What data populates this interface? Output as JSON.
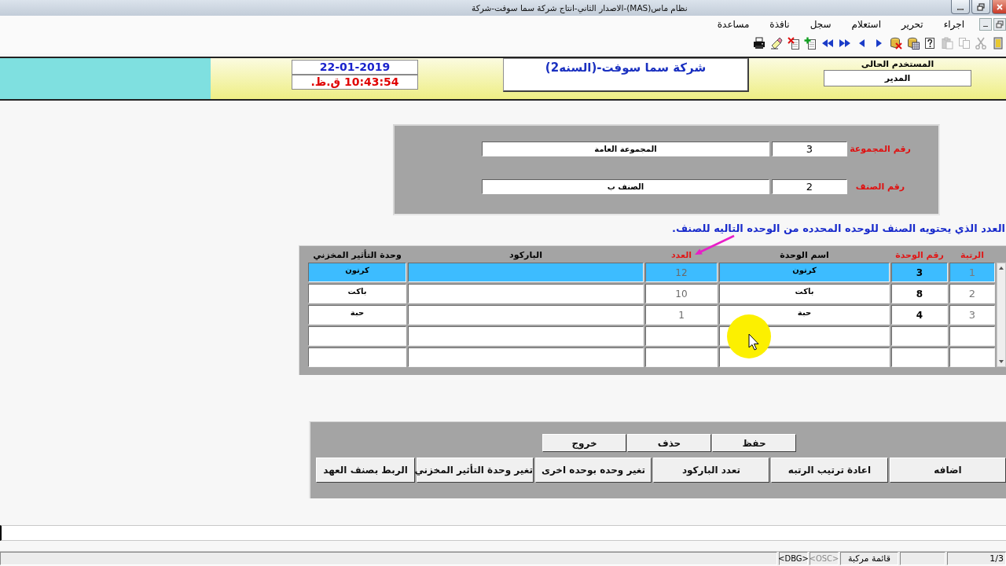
{
  "window": {
    "title": "نظام ماس(MAS)-الاصدار الثاني-انتاج شركة سما سوفت-شركة"
  },
  "menu": [
    "اجراء",
    "تحرير",
    "استعلام",
    "سجل",
    "نافذة",
    "مساعدة"
  ],
  "toolbar": [
    {
      "disabled": false
    },
    {
      "disabled": true
    },
    {
      "disabled": true
    },
    {
      "disabled": true
    },
    {
      "disabled": false
    },
    {
      "disabled": false
    },
    {
      "disabled": false
    },
    {
      "disabled": false
    },
    {
      "disabled": false
    },
    {
      "disabled": false
    },
    {
      "disabled": false
    },
    {
      "disabled": false
    },
    {
      "disabled": false
    },
    {
      "disabled": false
    },
    {
      "disabled": false
    }
  ],
  "header": {
    "date": "22-01-2019",
    "time": "10:43:54 ق.ظ.",
    "company": "شركة سما سوفت-(السنه2)",
    "user_label": "المستخدم الحالى",
    "user": "المدير"
  },
  "form": {
    "fields": [
      {
        "label": "رقم المجموعة",
        "code": "3",
        "name": "المجموعة العامة"
      },
      {
        "label": "رقم الصنف",
        "code": "2",
        "name": "الصنف ب"
      }
    ]
  },
  "instruction": "العدد الذي يحتويه الصنف للوحده المحدده من الوحده التاليه للصنف.",
  "grid": {
    "columns": [
      {
        "label": "الرتبة",
        "color": "#e01818"
      },
      {
        "label": "رقم الوحدة",
        "color": "#e01818"
      },
      {
        "label": "اسم الوحدة",
        "color": "#000000"
      },
      {
        "label": "العدد",
        "color": "#e01818"
      },
      {
        "label": "الباركود",
        "color": "#000000"
      },
      {
        "label": "وحدة التأثير المخزني",
        "color": "#000000"
      }
    ],
    "rows": [
      {
        "selected": true,
        "rank": "1",
        "unit_number": "3",
        "unit_name": "كرتون",
        "count": "12",
        "stock_unit": "كرتون"
      },
      {
        "selected": false,
        "rank": "2",
        "unit_number": "8",
        "unit_name": "باكت",
        "count": "10",
        "stock_unit": "باكت"
      },
      {
        "selected": false,
        "rank": "3",
        "unit_number": "4",
        "unit_name": "حبة",
        "count": "1",
        "stock_unit": "حبة"
      },
      {
        "selected": false
      },
      {
        "selected": false
      }
    ]
  },
  "actions": [
    "حفظ",
    "حذف",
    "خروج"
  ],
  "tools": [
    "اضافه",
    "اعادة ترتيب الرتبه",
    "تعدد الباركود",
    "تغير وحده بوحده اخرى",
    "تغير وحدة التأثير المخزني",
    "الربط بصنف العهد"
  ],
  "status_bar": {
    "page": "1/3",
    "mode": "قائمة مركبة",
    "flags": [
      {
        "label": "<OSC>",
        "on": false
      },
      {
        "label": "<DBG>",
        "on": true
      }
    ]
  }
}
